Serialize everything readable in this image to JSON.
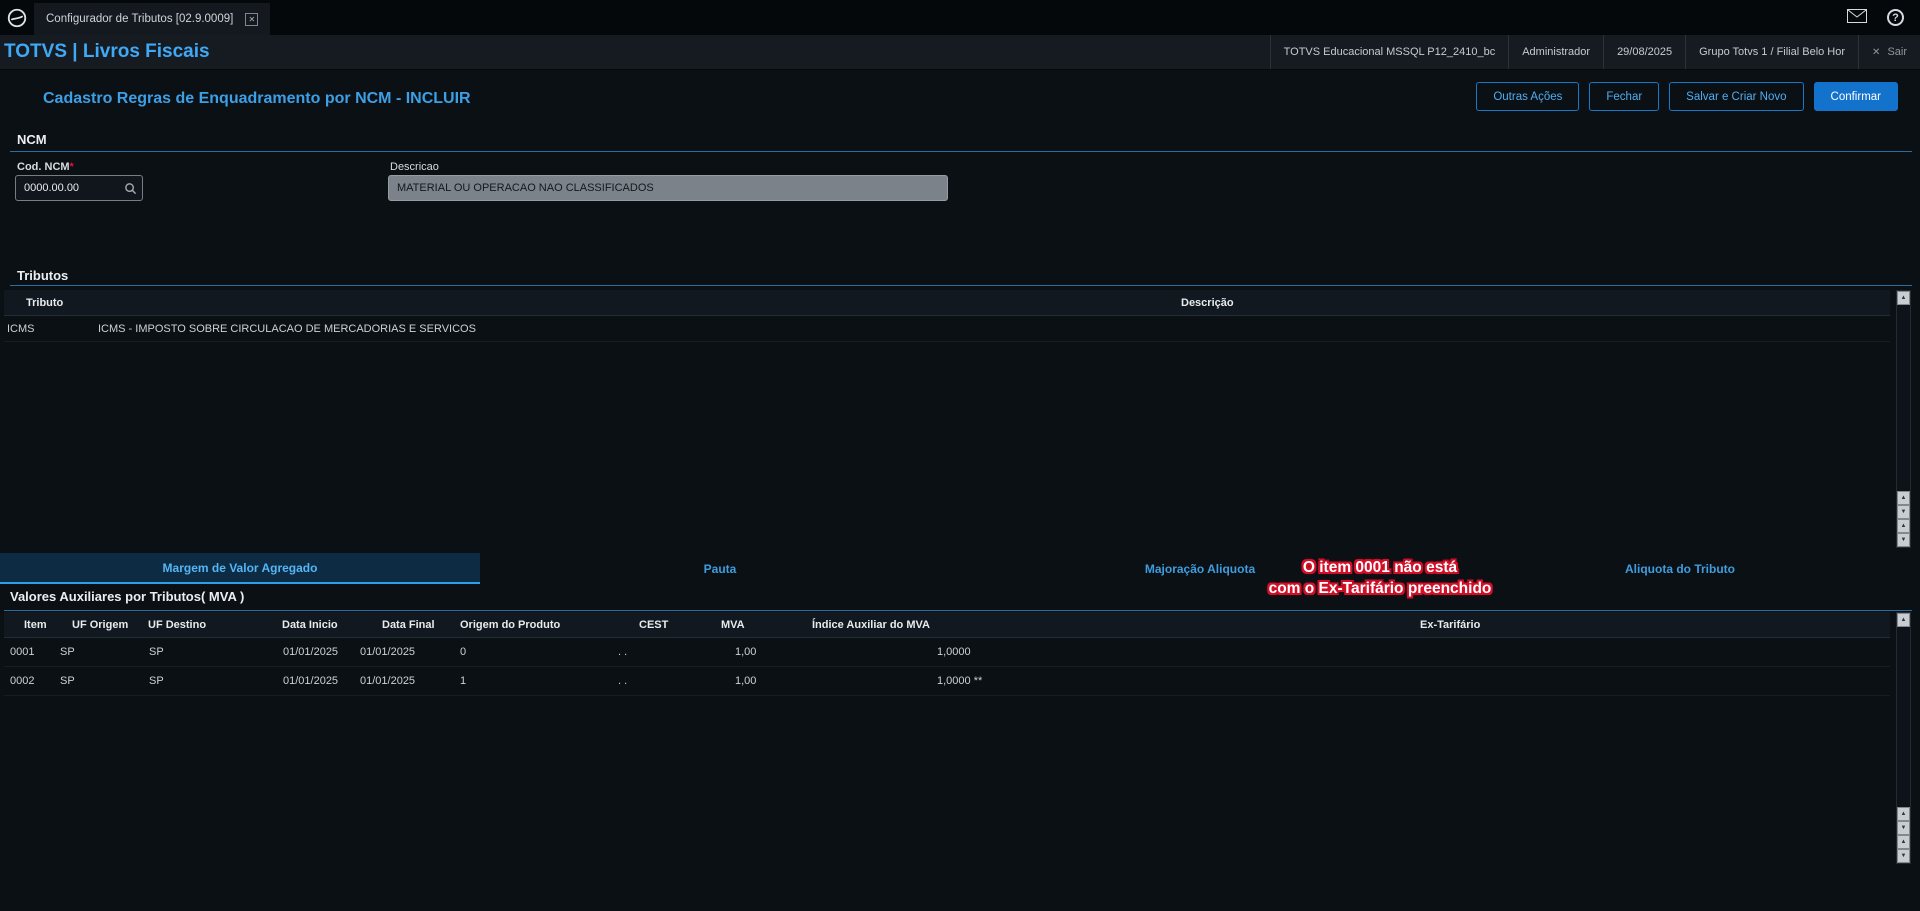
{
  "colors": {
    "accent_blue": "#3fa9f5",
    "button_blue": "#1272cc",
    "annotation_red": "#d40f28"
  },
  "icons": {
    "mail": "mail-envelope",
    "help": "?",
    "close_tab": "✕",
    "search": "magnifier",
    "exit_x": "✕",
    "arrow_up": "▲",
    "arrow_down": "▼"
  },
  "topbar": {
    "tab_title": "Configurador de Tributos [02.9.0009]"
  },
  "appbar": {
    "brand": "TOTVS | Livros Fiscais",
    "environment": "TOTVS Educacional MSSQL P12_2410_bc",
    "user": "Administrador",
    "date": "29/08/2025",
    "company": "Grupo Totvs 1 / Filial Belo Hor",
    "exit_label": "Sair"
  },
  "page": {
    "title": "Cadastro Regras de Enquadramento por NCM - INCLUIR",
    "actions": {
      "outras_acoes": "Outras Ações",
      "fechar": "Fechar",
      "salvar_criar_novo": "Salvar e Criar Novo",
      "confirmar": "Confirmar"
    }
  },
  "ncm": {
    "section_title": "NCM",
    "cod_label": "Cod. NCM",
    "required_marker": "*",
    "cod_value": "0000.00.00",
    "desc_label": "Descricao",
    "desc_value": "MATERIAL OU OPERACAO NAO CLASSIFICADOS"
  },
  "tributos": {
    "section_title": "Tributos",
    "columns": [
      "Tributo",
      "Descrição"
    ],
    "rows": [
      [
        "ICMS",
        "ICMS - IMPOSTO SOBRE CIRCULACAO DE MERCADORIAS E SERVICOS"
      ]
    ]
  },
  "tabs": [
    {
      "label": "Margem de Valor Agregado",
      "active": true
    },
    {
      "label": "Pauta",
      "active": false
    },
    {
      "label": "Majoração Aliquota",
      "active": false
    },
    {
      "label": "Aliquota do Tributo",
      "active": false
    }
  ],
  "mva": {
    "section_title": "Valores Auxiliares por Tributos( MVA )",
    "columns": [
      "Item",
      "UF Origem",
      "UF Destino",
      "Data Inicio",
      "Data Final",
      "Origem do Produto",
      "CEST",
      "MVA",
      "Índice Auxiliar do MVA",
      "Ex-Tarifário"
    ],
    "rows": [
      [
        "0001",
        "SP",
        "SP",
        "01/01/2025",
        "01/01/2025",
        "0",
        ". .",
        "1,00",
        "1,0000",
        ""
      ],
      [
        "0002",
        "SP",
        "SP",
        "01/01/2025",
        "01/01/2025",
        "1",
        ". .",
        "1,00",
        "1,0000  **",
        ""
      ]
    ]
  },
  "annotation": {
    "line1": "O item 0001 não está",
    "line2": "com o Ex-Tarifário preenchido"
  }
}
